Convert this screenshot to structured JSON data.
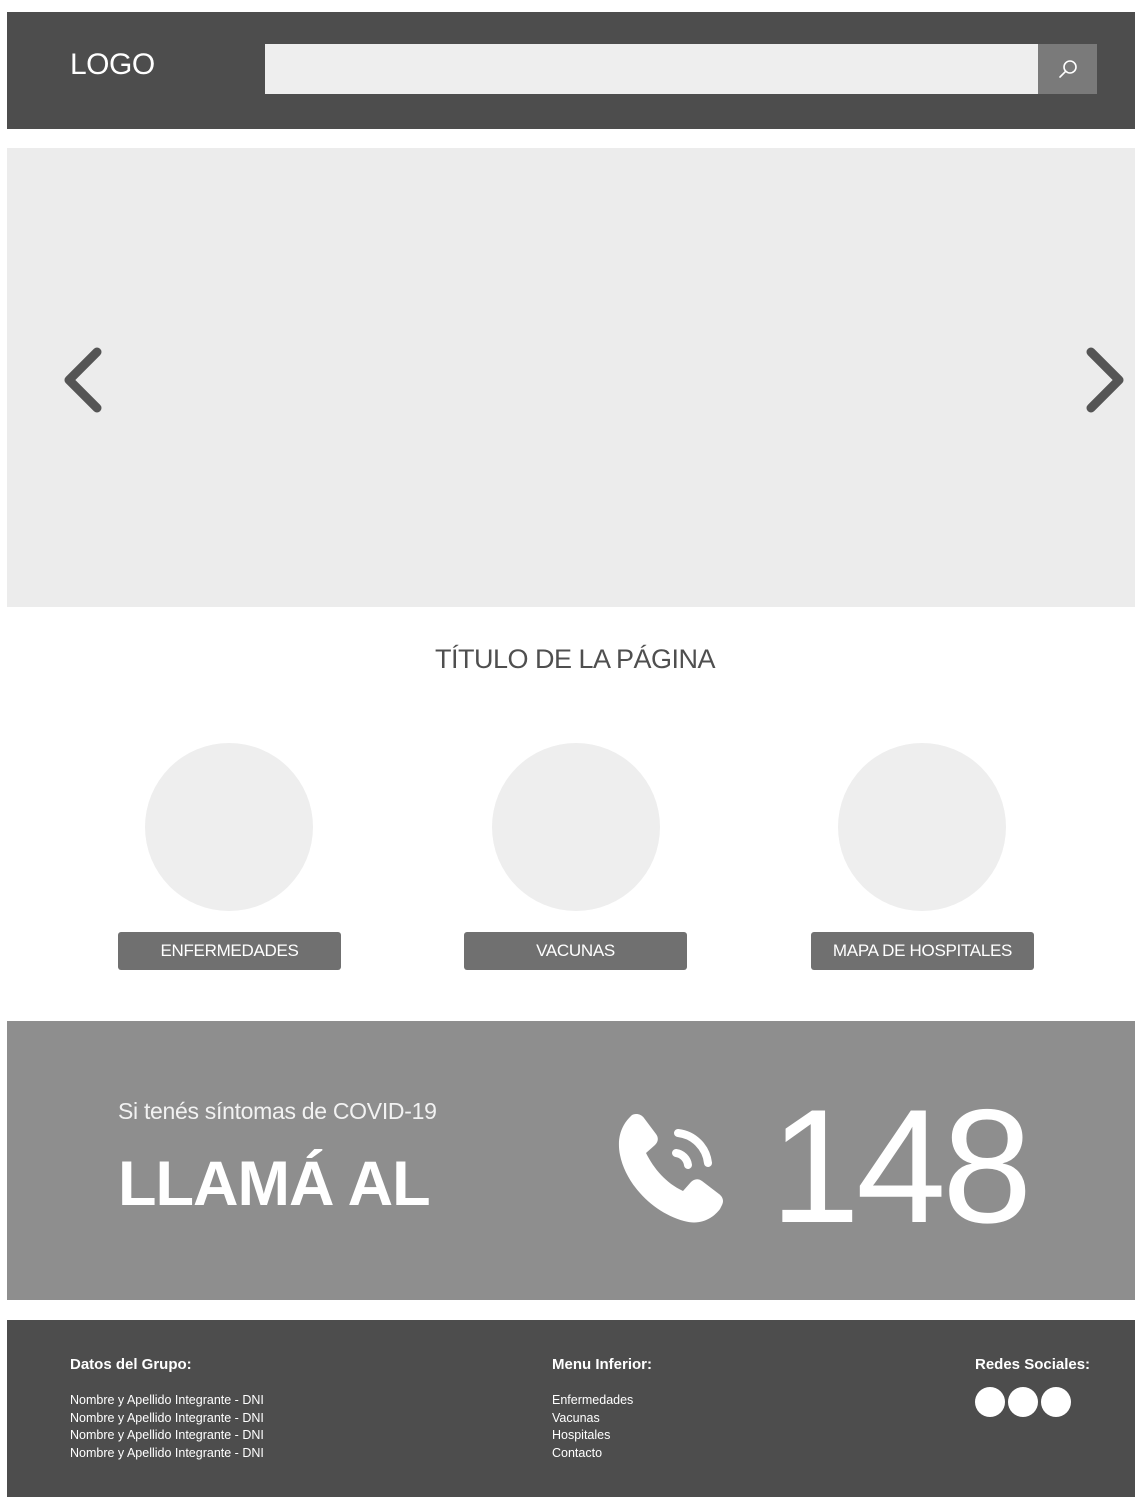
{
  "header": {
    "logo": "LOGO",
    "search": {
      "value": "",
      "placeholder": ""
    },
    "search_icon": "search-icon"
  },
  "slider": {
    "prev_icon": "chevron-left-icon",
    "next_icon": "chevron-right-icon"
  },
  "main": {
    "title": "TÍTULO DE LA PÁGINA",
    "categories": [
      {
        "label": "ENFERMEDADES"
      },
      {
        "label": "VACUNAS"
      },
      {
        "label": "MAPA DE HOSPITALES"
      }
    ]
  },
  "covid": {
    "subtitle": "Si tenés síntomas de COVID-19",
    "call": "LLAMÁ AL",
    "number": "148",
    "icon": "phone-icon"
  },
  "footer": {
    "group_title": "Datos del Grupo:",
    "members": [
      "Nombre y Apellido Integrante - DNI",
      "Nombre y Apellido Integrante - DNI",
      "Nombre y Apellido Integrante - DNI",
      "Nombre y Apellido Integrante - DNI"
    ],
    "menu_title": "Menu Inferior:",
    "menu": [
      "Enfermedades",
      "Vacunas",
      "Hospitales",
      "Contacto"
    ],
    "social_title": "Redes Sociales:"
  },
  "colors": {
    "header_bg": "#4d4d4d",
    "slider_bg": "#ececec",
    "button_bg": "#707070",
    "banner_bg": "#8e8e8e",
    "footer_bg": "#4d4d4d"
  }
}
